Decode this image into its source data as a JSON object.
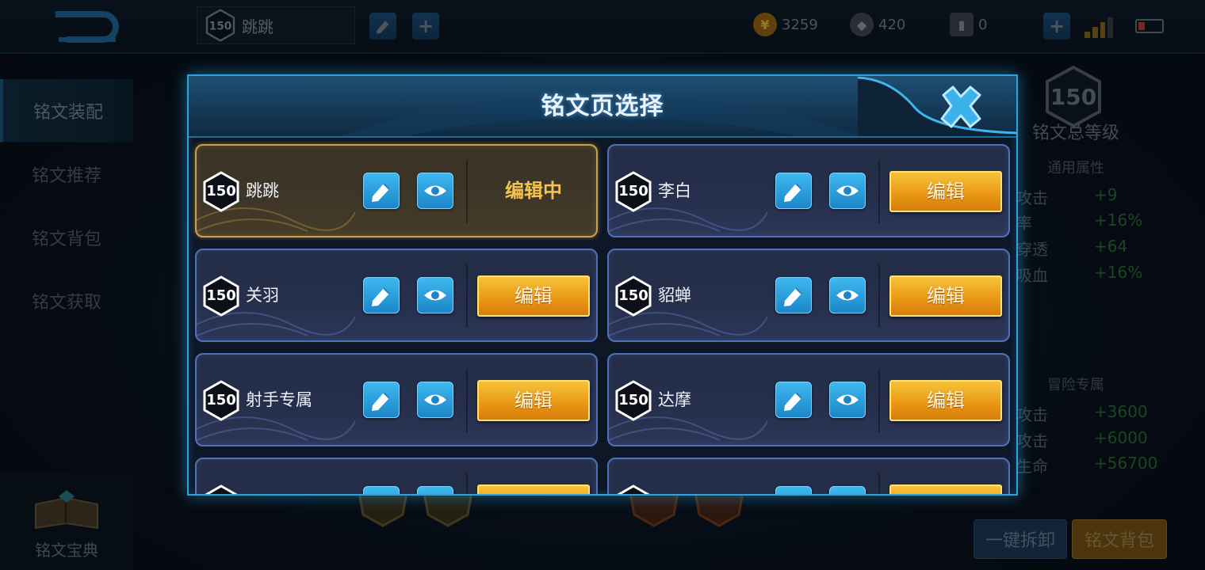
{
  "topbar": {
    "current_page": {
      "level": "150",
      "name": "跳跳"
    },
    "currencies": [
      {
        "icon": "gold-coin-icon",
        "value": "3259"
      },
      {
        "icon": "diamond-icon",
        "value": "420"
      },
      {
        "icon": "voucher-icon",
        "value": "0"
      }
    ]
  },
  "left_nav": {
    "items": [
      {
        "label": "铭文装配",
        "active": true
      },
      {
        "label": "铭文推荐",
        "active": false
      },
      {
        "label": "铭文背包",
        "active": false
      },
      {
        "label": "铭文获取",
        "active": false
      }
    ],
    "bottom_label": "铭文宝典"
  },
  "right_panel": {
    "level": "150",
    "total_label": "铭文总等级",
    "general_title": "通用属性",
    "general_attrs": [
      {
        "k": "攻击",
        "v": "+9"
      },
      {
        "k": "率",
        "v": "+16%"
      },
      {
        "k": "穿透",
        "v": "+64"
      },
      {
        "k": "吸血",
        "v": "+16%"
      }
    ],
    "adventure_title": "冒险专属",
    "adventure_attrs": [
      {
        "k": "攻击",
        "v": "+3600"
      },
      {
        "k": "攻击",
        "v": "+6000"
      },
      {
        "k": "生命",
        "v": "+56700"
      }
    ],
    "unload_label": "一键拆卸",
    "bag_label": "铭文背包"
  },
  "dialog": {
    "title": "铭文页选择",
    "pages": [
      {
        "level": "150",
        "name": "跳跳",
        "status": "编辑中",
        "active": true
      },
      {
        "level": "150",
        "name": "李白",
        "button": "编辑",
        "active": false
      },
      {
        "level": "150",
        "name": "关羽",
        "button": "编辑",
        "active": false
      },
      {
        "level": "150",
        "name": "貂蝉",
        "button": "编辑",
        "active": false
      },
      {
        "level": "150",
        "name": "射手专属",
        "button": "编辑",
        "active": false
      },
      {
        "level": "150",
        "name": "达摩",
        "button": "编辑",
        "active": false
      },
      {
        "level": "",
        "name": "",
        "button": "",
        "active": false
      },
      {
        "level": "",
        "name": "",
        "button": "",
        "active": false
      }
    ]
  },
  "colors": {
    "accent_blue": "#2aa4de",
    "edit_orange": "#ea9a16",
    "editing_gold": "#f4c34e",
    "card_border": "#5070b8"
  }
}
